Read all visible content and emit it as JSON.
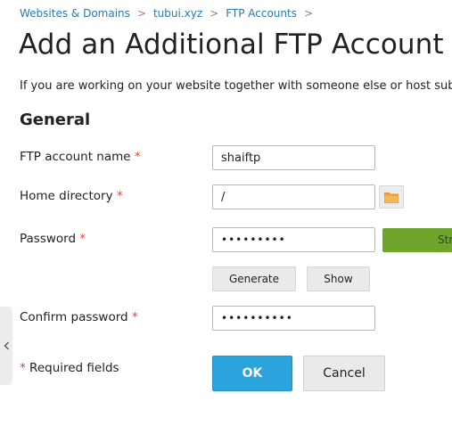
{
  "breadcrumb": {
    "items": [
      "Websites & Domains",
      "tubui.xyz",
      "FTP Accounts"
    ],
    "separator": ">"
  },
  "page": {
    "title": "Add an Additional FTP Account",
    "intro": "If you are working on your website together with someone else or host subdomains for other users, you can create additional FTP accounts."
  },
  "section": {
    "title": "General"
  },
  "form": {
    "ftp_name": {
      "label": "FTP account name",
      "value": "shaiftp"
    },
    "home_dir": {
      "label": "Home directory",
      "value": "/"
    },
    "password": {
      "label": "Password",
      "value": "•••••••••",
      "strength": "Strong"
    },
    "generate_label": "Generate",
    "show_label": "Show",
    "confirm": {
      "label": "Confirm password",
      "value": "••••••••••"
    },
    "required_asterisk": "*",
    "required_note": "Required fields"
  },
  "actions": {
    "ok_label": "OK",
    "cancel_label": "Cancel"
  },
  "colors": {
    "link": "#2a7ab0",
    "required": "#d24a3a",
    "primary": "#2ba3dc",
    "strength_strong": "#6fa52b",
    "folder": "#f0a040"
  },
  "icons": {
    "folder": "folder-icon",
    "collapse": "chevron-left-icon"
  }
}
